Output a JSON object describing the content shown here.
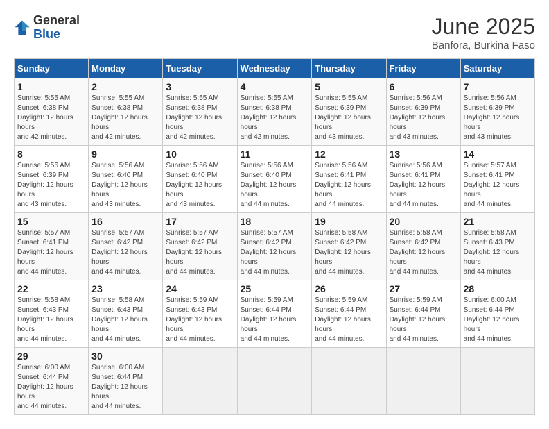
{
  "logo": {
    "general": "General",
    "blue": "Blue"
  },
  "title": "June 2025",
  "location": "Banfora, Burkina Faso",
  "days_of_week": [
    "Sunday",
    "Monday",
    "Tuesday",
    "Wednesday",
    "Thursday",
    "Friday",
    "Saturday"
  ],
  "weeks": [
    [
      {
        "day": 1,
        "sunrise": "5:55 AM",
        "sunset": "6:38 PM",
        "daylight": "12 hours and 42 minutes"
      },
      {
        "day": 2,
        "sunrise": "5:55 AM",
        "sunset": "6:38 PM",
        "daylight": "12 hours and 42 minutes"
      },
      {
        "day": 3,
        "sunrise": "5:55 AM",
        "sunset": "6:38 PM",
        "daylight": "12 hours and 42 minutes"
      },
      {
        "day": 4,
        "sunrise": "5:55 AM",
        "sunset": "6:38 PM",
        "daylight": "12 hours and 42 minutes"
      },
      {
        "day": 5,
        "sunrise": "5:55 AM",
        "sunset": "6:39 PM",
        "daylight": "12 hours and 43 minutes"
      },
      {
        "day": 6,
        "sunrise": "5:56 AM",
        "sunset": "6:39 PM",
        "daylight": "12 hours and 43 minutes"
      },
      {
        "day": 7,
        "sunrise": "5:56 AM",
        "sunset": "6:39 PM",
        "daylight": "12 hours and 43 minutes"
      }
    ],
    [
      {
        "day": 8,
        "sunrise": "5:56 AM",
        "sunset": "6:39 PM",
        "daylight": "12 hours and 43 minutes"
      },
      {
        "day": 9,
        "sunrise": "5:56 AM",
        "sunset": "6:40 PM",
        "daylight": "12 hours and 43 minutes"
      },
      {
        "day": 10,
        "sunrise": "5:56 AM",
        "sunset": "6:40 PM",
        "daylight": "12 hours and 43 minutes"
      },
      {
        "day": 11,
        "sunrise": "5:56 AM",
        "sunset": "6:40 PM",
        "daylight": "12 hours and 44 minutes"
      },
      {
        "day": 12,
        "sunrise": "5:56 AM",
        "sunset": "6:41 PM",
        "daylight": "12 hours and 44 minutes"
      },
      {
        "day": 13,
        "sunrise": "5:56 AM",
        "sunset": "6:41 PM",
        "daylight": "12 hours and 44 minutes"
      },
      {
        "day": 14,
        "sunrise": "5:57 AM",
        "sunset": "6:41 PM",
        "daylight": "12 hours and 44 minutes"
      }
    ],
    [
      {
        "day": 15,
        "sunrise": "5:57 AM",
        "sunset": "6:41 PM",
        "daylight": "12 hours and 44 minutes"
      },
      {
        "day": 16,
        "sunrise": "5:57 AM",
        "sunset": "6:42 PM",
        "daylight": "12 hours and 44 minutes"
      },
      {
        "day": 17,
        "sunrise": "5:57 AM",
        "sunset": "6:42 PM",
        "daylight": "12 hours and 44 minutes"
      },
      {
        "day": 18,
        "sunrise": "5:57 AM",
        "sunset": "6:42 PM",
        "daylight": "12 hours and 44 minutes"
      },
      {
        "day": 19,
        "sunrise": "5:58 AM",
        "sunset": "6:42 PM",
        "daylight": "12 hours and 44 minutes"
      },
      {
        "day": 20,
        "sunrise": "5:58 AM",
        "sunset": "6:42 PM",
        "daylight": "12 hours and 44 minutes"
      },
      {
        "day": 21,
        "sunrise": "5:58 AM",
        "sunset": "6:43 PM",
        "daylight": "12 hours and 44 minutes"
      }
    ],
    [
      {
        "day": 22,
        "sunrise": "5:58 AM",
        "sunset": "6:43 PM",
        "daylight": "12 hours and 44 minutes"
      },
      {
        "day": 23,
        "sunrise": "5:58 AM",
        "sunset": "6:43 PM",
        "daylight": "12 hours and 44 minutes"
      },
      {
        "day": 24,
        "sunrise": "5:59 AM",
        "sunset": "6:43 PM",
        "daylight": "12 hours and 44 minutes"
      },
      {
        "day": 25,
        "sunrise": "5:59 AM",
        "sunset": "6:44 PM",
        "daylight": "12 hours and 44 minutes"
      },
      {
        "day": 26,
        "sunrise": "5:59 AM",
        "sunset": "6:44 PM",
        "daylight": "12 hours and 44 minutes"
      },
      {
        "day": 27,
        "sunrise": "5:59 AM",
        "sunset": "6:44 PM",
        "daylight": "12 hours and 44 minutes"
      },
      {
        "day": 28,
        "sunrise": "6:00 AM",
        "sunset": "6:44 PM",
        "daylight": "12 hours and 44 minutes"
      }
    ],
    [
      {
        "day": 29,
        "sunrise": "6:00 AM",
        "sunset": "6:44 PM",
        "daylight": "12 hours and 44 minutes"
      },
      {
        "day": 30,
        "sunrise": "6:00 AM",
        "sunset": "6:44 PM",
        "daylight": "12 hours and 44 minutes"
      },
      null,
      null,
      null,
      null,
      null
    ]
  ]
}
